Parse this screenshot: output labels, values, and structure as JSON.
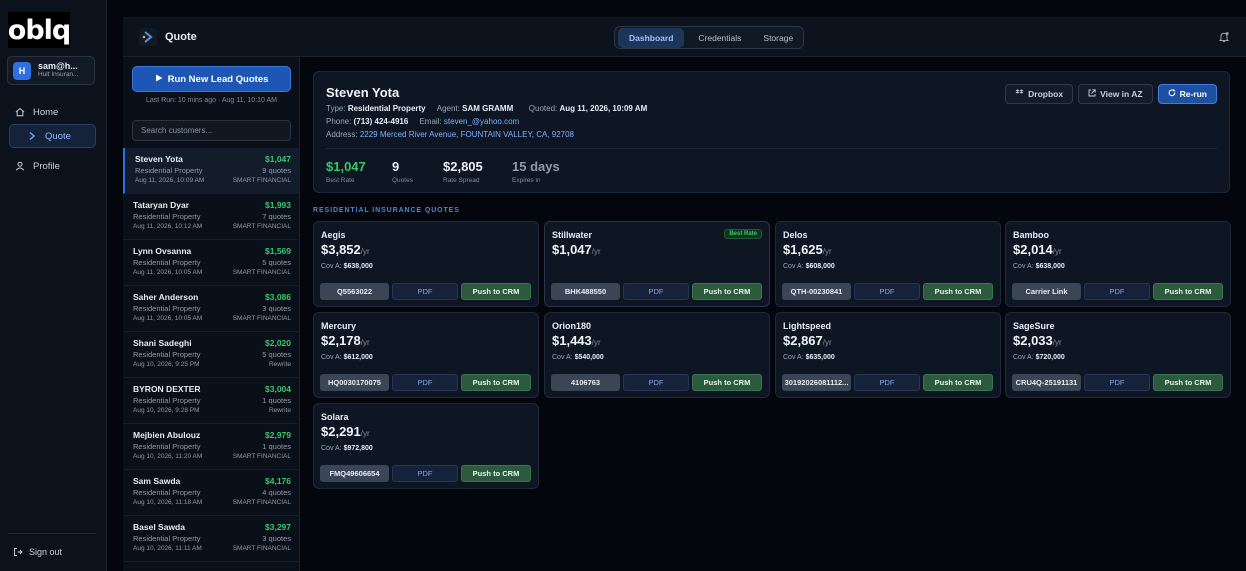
{
  "sidebar": {
    "logo": "oblq",
    "user": {
      "initial": "H",
      "name": "sam@h...",
      "org": "Hult Insuran..."
    },
    "items": [
      {
        "label": "Home",
        "icon": "home-icon"
      },
      {
        "label": "Quote",
        "icon": "quote-icon"
      },
      {
        "label": "Profile",
        "icon": "user-icon"
      }
    ],
    "signout": "Sign out"
  },
  "header": {
    "title": "Quote",
    "tabs": [
      "Dashboard",
      "Credentials",
      "Storage"
    ],
    "active_tab": "Dashboard"
  },
  "leads": {
    "run_button": "Run New Lead Quotes",
    "last_run": "Last Run: 10 mins ago · Aug 11, 10:10 AM",
    "search_placeholder": "Search customers...",
    "items": [
      {
        "name": "Steven Yota",
        "price": "$1,047",
        "type": "Residential Property",
        "quotes": "9 quotes",
        "date": "Aug 11, 2026, 10:09 AM",
        "carrier": "SMART FINANCIAL"
      },
      {
        "name": "Tataryan Dyar",
        "price": "$1,993",
        "type": "Residential Property",
        "quotes": "7 quotes",
        "date": "Aug 11, 2026, 10:12 AM",
        "carrier": "SMART FINANCIAL"
      },
      {
        "name": "Lynn Ovsanna",
        "price": "$1,569",
        "type": "Residential Property",
        "quotes": "5 quotes",
        "date": "Aug 11, 2026, 10:05 AM",
        "carrier": "SMART FINANCIAL"
      },
      {
        "name": "Saher Anderson",
        "price": "$3,086",
        "type": "Residential Property",
        "quotes": "3 quotes",
        "date": "Aug 11, 2026, 10:05 AM",
        "carrier": "SMART FINANCIAL"
      },
      {
        "name": "Shani Sadeghi",
        "price": "$2,020",
        "type": "Residential Property",
        "quotes": "5 quotes",
        "date": "Aug 10, 2026, 9:25 PM",
        "carrier": "Rewrite"
      },
      {
        "name": "BYRON DEXTER",
        "price": "$3,004",
        "type": "Residential Property",
        "quotes": "1 quotes",
        "date": "Aug 10, 2026, 9:28 PM",
        "carrier": "Rewrite"
      },
      {
        "name": "Mejbien Abulouz",
        "price": "$2,979",
        "type": "Residential Property",
        "quotes": "1 quotes",
        "date": "Aug 10, 2026, 11:20 AM",
        "carrier": "SMART FINANCIAL"
      },
      {
        "name": "Sam Sawda",
        "price": "$4,176",
        "type": "Residential Property",
        "quotes": "4 quotes",
        "date": "Aug 10, 2026, 11:18 AM",
        "carrier": "SMART FINANCIAL"
      },
      {
        "name": "Basel Sawda",
        "price": "$3,297",
        "type": "Residential Property",
        "quotes": "3 quotes",
        "date": "Aug 10, 2026, 11:11 AM",
        "carrier": "SMART FINANCIAL"
      }
    ]
  },
  "customer": {
    "name": "Steven Yota",
    "type_label": "Type:",
    "type": "Residential Property",
    "agent_label": "Agent:",
    "agent": "SAM GRAMM",
    "quoted_label": "Quoted:",
    "quoted": "Aug 11, 2026, 10:09 AM",
    "phone_label": "Phone:",
    "phone": "(713) 424-4916",
    "email_label": "Email:",
    "email": "steven_@yahoo.com",
    "address_label": "Address:",
    "address": "2229 Merced River Avenue, FOUNTAIN VALLEY, CA, 92708",
    "buttons": {
      "dropbox": "Dropbox",
      "view": "View in AZ",
      "rerun": "Re-run"
    },
    "stats": [
      {
        "value": "$1,047",
        "label": "Best Rate"
      },
      {
        "value": "9",
        "label": "Quotes"
      },
      {
        "value": "$2,805",
        "label": "Rate Spread"
      },
      {
        "value": "15 days",
        "label": "Expires in"
      }
    ]
  },
  "quotes_section": "RESIDENTIAL INSURANCE QUOTES",
  "quotes": [
    {
      "carrier": "Aegis",
      "price": "$3,852",
      "per": "/yr",
      "cov_label": "Cov A:",
      "cov": "$638,000",
      "ref": "Q5563022",
      "pdf": "PDF",
      "crm": "Push to CRM",
      "badge": ""
    },
    {
      "carrier": "Stillwater",
      "price": "$1,047",
      "per": "/yr",
      "cov_label": "",
      "cov": "",
      "ref": "BHK488550",
      "pdf": "PDF",
      "crm": "Push to CRM",
      "badge": "Best Rate"
    },
    {
      "carrier": "Delos",
      "price": "$1,625",
      "per": "/yr",
      "cov_label": "Cov A:",
      "cov": "$608,000",
      "ref": "QTH-00230841",
      "pdf": "PDF",
      "crm": "Push to CRM",
      "badge": ""
    },
    {
      "carrier": "Bamboo",
      "price": "$2,014",
      "per": "/yr",
      "cov_label": "Cov A:",
      "cov": "$638,000",
      "ref": "Carrier Link",
      "pdf": "PDF",
      "crm": "Push to CRM",
      "badge": ""
    },
    {
      "carrier": "Mercury",
      "price": "$2,178",
      "per": "/yr",
      "cov_label": "Cov A:",
      "cov": "$612,000",
      "ref": "HQ0030170075",
      "pdf": "PDF",
      "crm": "Push to CRM",
      "badge": ""
    },
    {
      "carrier": "Orion180",
      "price": "$1,443",
      "per": "/yr",
      "cov_label": "Cov A:",
      "cov": "$540,000",
      "ref": "4106763",
      "pdf": "PDF",
      "crm": "Push to CRM",
      "badge": ""
    },
    {
      "carrier": "Lightspeed",
      "price": "$2,867",
      "per": "/yr",
      "cov_label": "Cov A:",
      "cov": "$635,000",
      "ref": "30192026081112...",
      "pdf": "PDF",
      "crm": "Push to CRM",
      "badge": ""
    },
    {
      "carrier": "SageSure",
      "price": "$2,033",
      "per": "/yr",
      "cov_label": "Cov A:",
      "cov": "$720,000",
      "ref": "CRU4Q-25191131",
      "pdf": "PDF",
      "crm": "Push to CRM",
      "badge": ""
    },
    {
      "carrier": "Solara",
      "price": "$2,291",
      "per": "/yr",
      "cov_label": "Cov A:",
      "cov": "$972,800",
      "ref": "FMQ49606654",
      "pdf": "PDF",
      "crm": "Push to CRM",
      "badge": ""
    }
  ]
}
